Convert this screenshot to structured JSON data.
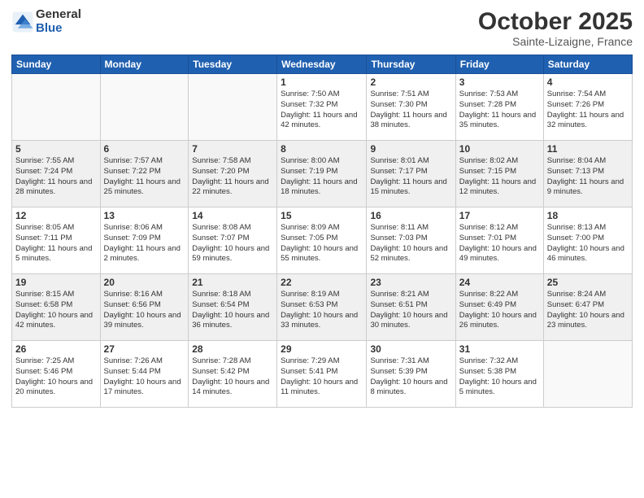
{
  "logo": {
    "general": "General",
    "blue": "Blue"
  },
  "header": {
    "month": "October 2025",
    "location": "Sainte-Lizaigne, France"
  },
  "weekdays": [
    "Sunday",
    "Monday",
    "Tuesday",
    "Wednesday",
    "Thursday",
    "Friday",
    "Saturday"
  ],
  "weeks": [
    [
      {
        "day": "",
        "info": ""
      },
      {
        "day": "",
        "info": ""
      },
      {
        "day": "",
        "info": ""
      },
      {
        "day": "1",
        "info": "Sunrise: 7:50 AM\nSunset: 7:32 PM\nDaylight: 11 hours\nand 42 minutes."
      },
      {
        "day": "2",
        "info": "Sunrise: 7:51 AM\nSunset: 7:30 PM\nDaylight: 11 hours\nand 38 minutes."
      },
      {
        "day": "3",
        "info": "Sunrise: 7:53 AM\nSunset: 7:28 PM\nDaylight: 11 hours\nand 35 minutes."
      },
      {
        "day": "4",
        "info": "Sunrise: 7:54 AM\nSunset: 7:26 PM\nDaylight: 11 hours\nand 32 minutes."
      }
    ],
    [
      {
        "day": "5",
        "info": "Sunrise: 7:55 AM\nSunset: 7:24 PM\nDaylight: 11 hours\nand 28 minutes."
      },
      {
        "day": "6",
        "info": "Sunrise: 7:57 AM\nSunset: 7:22 PM\nDaylight: 11 hours\nand 25 minutes."
      },
      {
        "day": "7",
        "info": "Sunrise: 7:58 AM\nSunset: 7:20 PM\nDaylight: 11 hours\nand 22 minutes."
      },
      {
        "day": "8",
        "info": "Sunrise: 8:00 AM\nSunset: 7:19 PM\nDaylight: 11 hours\nand 18 minutes."
      },
      {
        "day": "9",
        "info": "Sunrise: 8:01 AM\nSunset: 7:17 PM\nDaylight: 11 hours\nand 15 minutes."
      },
      {
        "day": "10",
        "info": "Sunrise: 8:02 AM\nSunset: 7:15 PM\nDaylight: 11 hours\nand 12 minutes."
      },
      {
        "day": "11",
        "info": "Sunrise: 8:04 AM\nSunset: 7:13 PM\nDaylight: 11 hours\nand 9 minutes."
      }
    ],
    [
      {
        "day": "12",
        "info": "Sunrise: 8:05 AM\nSunset: 7:11 PM\nDaylight: 11 hours\nand 5 minutes."
      },
      {
        "day": "13",
        "info": "Sunrise: 8:06 AM\nSunset: 7:09 PM\nDaylight: 11 hours\nand 2 minutes."
      },
      {
        "day": "14",
        "info": "Sunrise: 8:08 AM\nSunset: 7:07 PM\nDaylight: 10 hours\nand 59 minutes."
      },
      {
        "day": "15",
        "info": "Sunrise: 8:09 AM\nSunset: 7:05 PM\nDaylight: 10 hours\nand 55 minutes."
      },
      {
        "day": "16",
        "info": "Sunrise: 8:11 AM\nSunset: 7:03 PM\nDaylight: 10 hours\nand 52 minutes."
      },
      {
        "day": "17",
        "info": "Sunrise: 8:12 AM\nSunset: 7:01 PM\nDaylight: 10 hours\nand 49 minutes."
      },
      {
        "day": "18",
        "info": "Sunrise: 8:13 AM\nSunset: 7:00 PM\nDaylight: 10 hours\nand 46 minutes."
      }
    ],
    [
      {
        "day": "19",
        "info": "Sunrise: 8:15 AM\nSunset: 6:58 PM\nDaylight: 10 hours\nand 42 minutes."
      },
      {
        "day": "20",
        "info": "Sunrise: 8:16 AM\nSunset: 6:56 PM\nDaylight: 10 hours\nand 39 minutes."
      },
      {
        "day": "21",
        "info": "Sunrise: 8:18 AM\nSunset: 6:54 PM\nDaylight: 10 hours\nand 36 minutes."
      },
      {
        "day": "22",
        "info": "Sunrise: 8:19 AM\nSunset: 6:53 PM\nDaylight: 10 hours\nand 33 minutes."
      },
      {
        "day": "23",
        "info": "Sunrise: 8:21 AM\nSunset: 6:51 PM\nDaylight: 10 hours\nand 30 minutes."
      },
      {
        "day": "24",
        "info": "Sunrise: 8:22 AM\nSunset: 6:49 PM\nDaylight: 10 hours\nand 26 minutes."
      },
      {
        "day": "25",
        "info": "Sunrise: 8:24 AM\nSunset: 6:47 PM\nDaylight: 10 hours\nand 23 minutes."
      }
    ],
    [
      {
        "day": "26",
        "info": "Sunrise: 7:25 AM\nSunset: 5:46 PM\nDaylight: 10 hours\nand 20 minutes."
      },
      {
        "day": "27",
        "info": "Sunrise: 7:26 AM\nSunset: 5:44 PM\nDaylight: 10 hours\nand 17 minutes."
      },
      {
        "day": "28",
        "info": "Sunrise: 7:28 AM\nSunset: 5:42 PM\nDaylight: 10 hours\nand 14 minutes."
      },
      {
        "day": "29",
        "info": "Sunrise: 7:29 AM\nSunset: 5:41 PM\nDaylight: 10 hours\nand 11 minutes."
      },
      {
        "day": "30",
        "info": "Sunrise: 7:31 AM\nSunset: 5:39 PM\nDaylight: 10 hours\nand 8 minutes."
      },
      {
        "day": "31",
        "info": "Sunrise: 7:32 AM\nSunset: 5:38 PM\nDaylight: 10 hours\nand 5 minutes."
      },
      {
        "day": "",
        "info": ""
      }
    ]
  ]
}
